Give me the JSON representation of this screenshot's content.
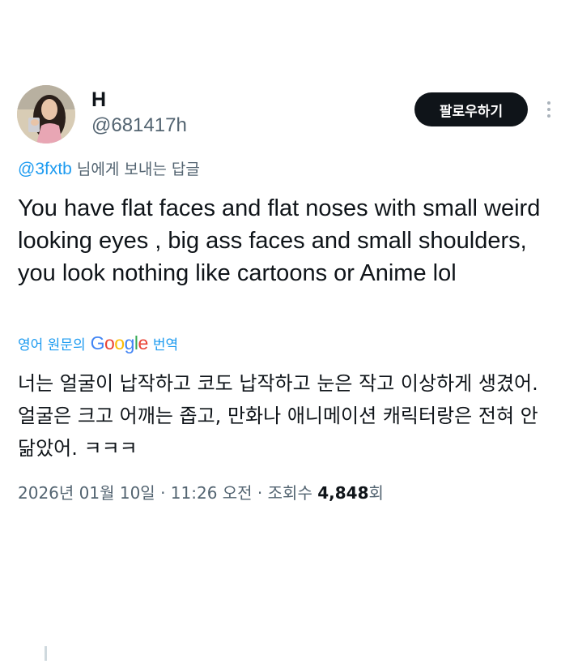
{
  "author": {
    "name": "H",
    "handle": "@681417h",
    "avatar_icon": "profile-photo"
  },
  "header": {
    "follow_label": "팔로우하기",
    "more_icon": "more-vertical-icon"
  },
  "reply": {
    "mention": "@3fxtb",
    "suffix": " 님에게 보내는 답글"
  },
  "tweet": {
    "text": "You have flat faces and flat noses with small weird looking eyes , big ass faces and small shoulders, you look nothing like cartoons or Anime lol"
  },
  "translation": {
    "prefix": "영어 원문의",
    "google": [
      "G",
      "o",
      "o",
      "g",
      "l",
      "e"
    ],
    "google_colors": [
      "#4285f4",
      "#ea4335",
      "#fbbc05",
      "#4285f4",
      "#34a853",
      "#ea4335"
    ],
    "suffix": "번역",
    "text": "너는 얼굴이 납작하고 코도 납작하고 눈은 작고 이상하게 생겼어. 얼굴은 크고 어깨는 좁고, 만화나 애니메이션 캐릭터랑은 전혀 안 닮았어. ㅋㅋㅋ"
  },
  "meta": {
    "datetime": "2026년 01월 10일 · 11:26 오전 · 조회수 ",
    "views": "4,848",
    "views_suffix": "회"
  },
  "colors": {
    "accent": "#1d9bf0",
    "text": "#0f1419",
    "secondary": "#536471",
    "button_bg": "#0f1419"
  }
}
